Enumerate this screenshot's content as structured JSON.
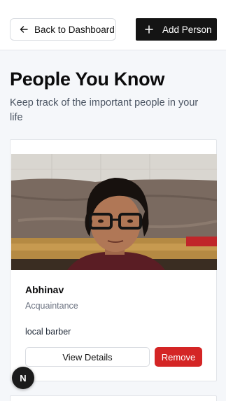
{
  "header": {
    "back_label": "Back to Dashboard",
    "add_label": "Add Person"
  },
  "main": {
    "title": "People You Know",
    "subtitle": "Keep track of the important people in your life"
  },
  "cards": [
    {
      "name": "Abhinav",
      "relation": "Acquaintance",
      "note": "local barber",
      "view_label": "View Details",
      "remove_label": "Remove"
    }
  ],
  "dev_badge": {
    "letter": "N"
  },
  "colors": {
    "primary_button": "#141414",
    "danger_button": "#d42525",
    "page_background": "#f5f7fa"
  },
  "icons": {
    "back": "arrow-left-icon",
    "add": "plus-icon",
    "dev": "next-logo-icon"
  }
}
